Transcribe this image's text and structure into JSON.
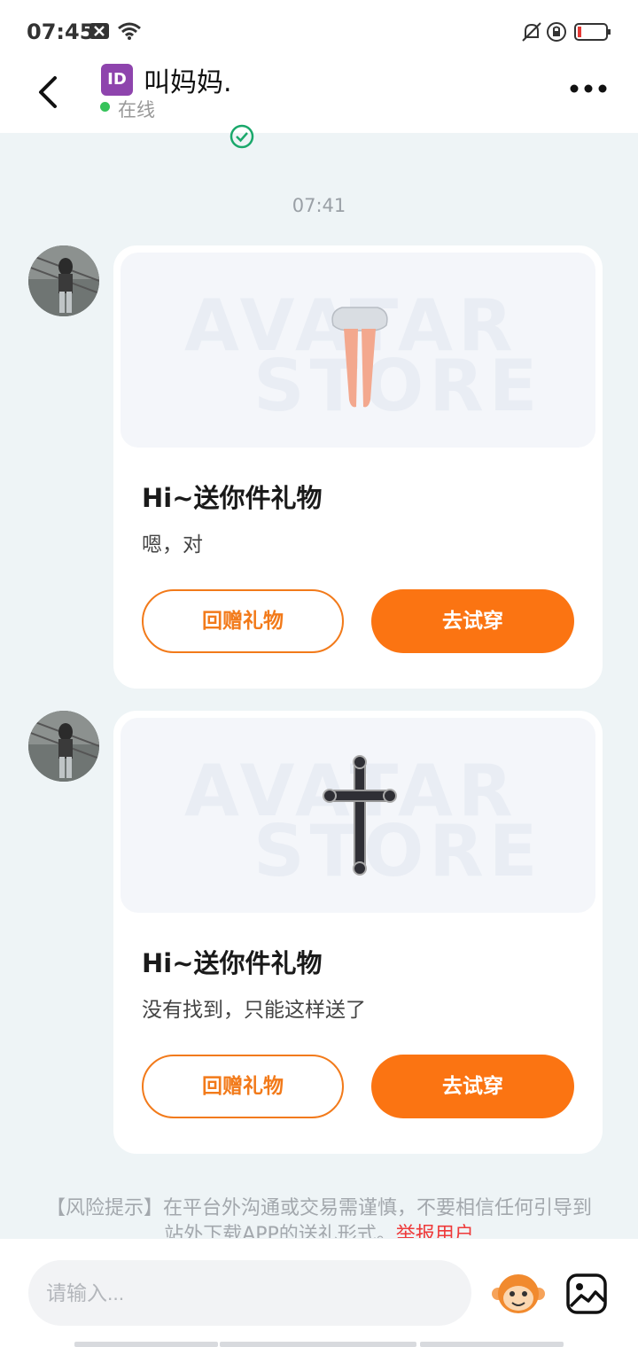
{
  "status_bar": {
    "time": "07:45"
  },
  "header": {
    "id_badge": "ID",
    "contact_name": "叫妈妈.",
    "status": "在线"
  },
  "chat": {
    "timestamp": "07:41",
    "messages": [
      {
        "title": "Hi~送你件礼物",
        "text": "嗯，对",
        "return_label": "回赠礼物",
        "try_label": "去试穿",
        "watermark_top": "AVATAR",
        "watermark_bottom": "STORE",
        "gift_icon": "skirt-legs-icon"
      },
      {
        "title": "Hi~送你件礼物",
        "text": "没有找到，只能这样送了",
        "return_label": "回赠礼物",
        "try_label": "去试穿",
        "watermark_top": "AVATAR",
        "watermark_bottom": "STORE",
        "gift_icon": "cross-necklace-icon"
      }
    ]
  },
  "risk_notice": {
    "text": "【风险提示】在平台外沟通或交易需谨慎，不要相信任何引导到站外下载APP的送礼形式。",
    "report_link": "举报用户"
  },
  "input": {
    "placeholder": "请输入..."
  },
  "colors": {
    "accent": "#fb7412",
    "online": "#35c35a",
    "report": "#ee3a3a"
  }
}
